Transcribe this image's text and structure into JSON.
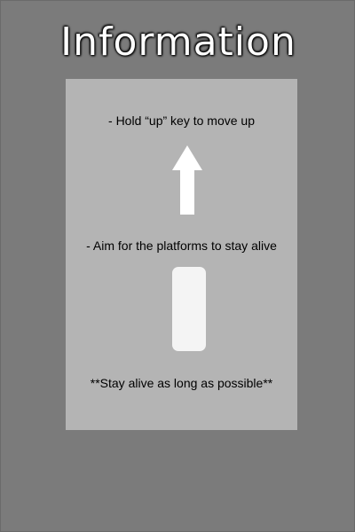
{
  "screen": {
    "title": "Information"
  },
  "info_panel": {
    "move_instruction": "- Hold “up” key to move up",
    "platform_instruction": "- Aim for the platforms to stay alive",
    "goal_text": "**Stay alive as long as possible**"
  },
  "icons": {
    "up_arrow": "up-arrow-icon",
    "platform": "platform-icon"
  },
  "colors": {
    "background": "#7b7b7b",
    "panel": "#b4b4b4",
    "arrow": "#ffffff",
    "platform": "#f4f4f4",
    "title_text": "#ffffff"
  }
}
